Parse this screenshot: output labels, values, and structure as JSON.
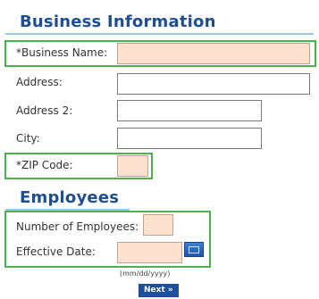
{
  "business_section": {
    "title": "Business Information",
    "business_name_label": "*Business Name:",
    "address_label": "Address:",
    "address2_label": "Address 2:",
    "city_label": "City:",
    "zip_label": "*ZIP Code:"
  },
  "employees_section": {
    "title": "Employees",
    "num_employees_label": "Number of Employees:",
    "effective_date_label": "Effective Date:",
    "date_hint": "(mm/dd/yyyy)"
  },
  "actions": {
    "next_label": "Next »"
  },
  "colors": {
    "heading": "#1f4f8f",
    "required_field_bg": "#fde3cf",
    "highlight_border": "#4caf50",
    "next_button_bg": "#1d4f9f"
  }
}
